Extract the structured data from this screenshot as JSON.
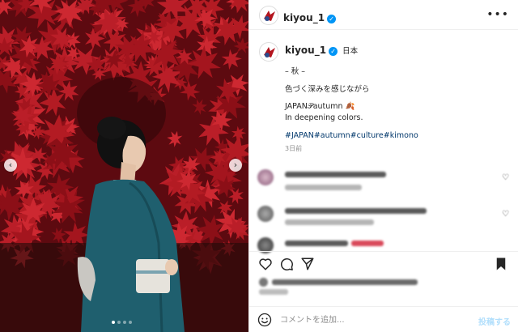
{
  "post": {
    "username": "kiyou_1",
    "location": "日本",
    "verified_icon": "verified-badge-icon",
    "caption_lines": [
      "– 秋 –",
      "色づく深みを感じながら",
      "JAPAN𝒫autumn",
      "In deepening colors."
    ],
    "hashtags": "#JAPAN#autumn#culture#kimono",
    "time_ago": "3日前"
  },
  "comment_box": {
    "placeholder": "コメントを追加...",
    "post_label": "投稿する"
  },
  "carousel": {
    "total": 4,
    "current": 1
  },
  "colors": {
    "accent_blue": "#0095f6",
    "hashtag_blue": "#00376b",
    "post_disabled": "#b2dffc",
    "maple_red": "#b3141e"
  },
  "icons": [
    "more-options-icon",
    "heart-icon",
    "comment-icon",
    "share-icon",
    "bookmark-icon",
    "emoji-icon",
    "chevron-left-icon",
    "chevron-right-icon"
  ]
}
